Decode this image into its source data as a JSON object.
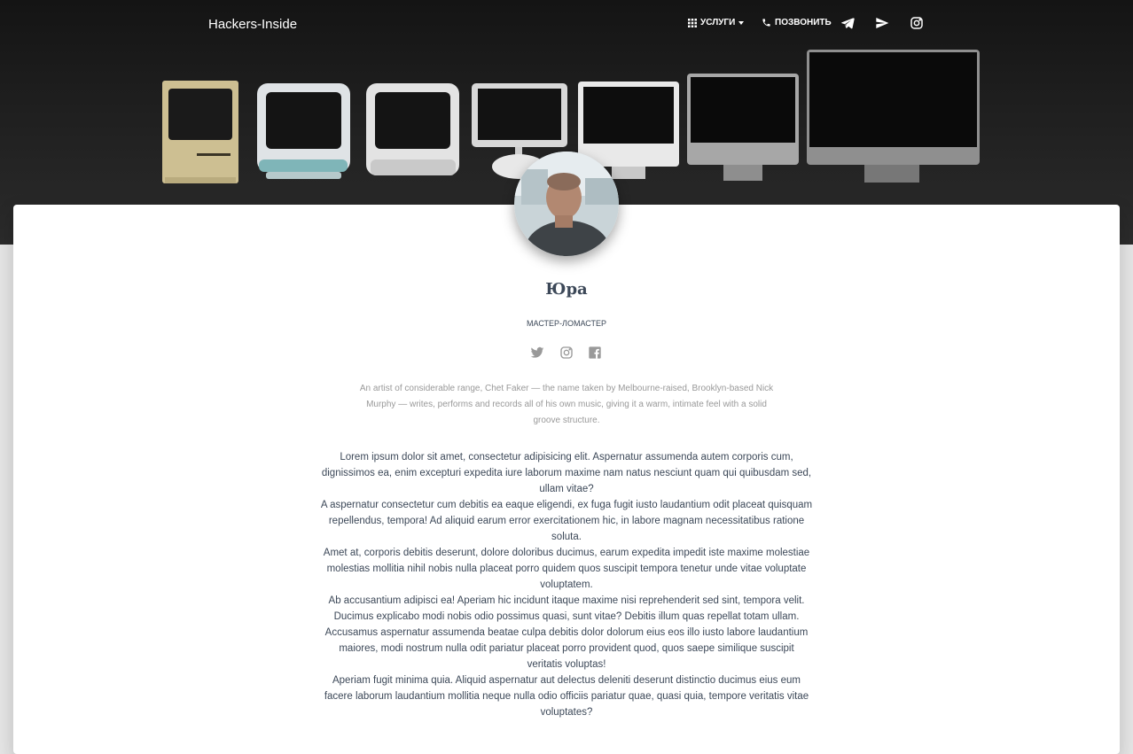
{
  "nav": {
    "brand": "Hackers-Inside",
    "services_label": "УСЛУГИ",
    "call_label": "ПОЗВОНИТЬ",
    "icons": [
      "apps-icon",
      "phone-icon",
      "telegram-icon",
      "send-icon",
      "instagram-icon"
    ]
  },
  "profile": {
    "name": "Юра",
    "title": "МАСТЕР-ЛОМАСТЕР",
    "social_icons": [
      "twitter-icon",
      "instagram-icon",
      "facebook-icon"
    ],
    "bio": "An artist of considerable range, Chet Faker — the name taken by Melbourne-raised, Brooklyn-based Nick Murphy — writes, performs and records all of his own music, giving it a warm, intimate feel with a solid groove structure."
  },
  "paragraphs": [
    "Lorem ipsum dolor sit amet, consectetur adipisicing elit. Aspernatur assumenda autem corporis cum, dignissimos ea, enim excepturi expedita iure laborum maxime nam natus nesciunt quam qui quibusdam sed, ullam vitae?",
    "A aspernatur consectetur cum debitis ea eaque eligendi, ex fuga fugit iusto laudantium odit placeat quisquam repellendus, tempora! Ad aliquid earum error exercitationem hic, in labore magnam necessitatibus ratione soluta.",
    "Amet at, corporis debitis deserunt, dolore doloribus ducimus, earum expedita impedit iste maxime molestiae molestias mollitia nihil nobis nulla placeat porro quidem quos suscipit tempora tenetur unde vitae voluptate voluptatem.",
    "Ab accusantium adipisci ea! Aperiam hic incidunt itaque maxime nisi reprehenderit sed sint, tempora velit. Ducimus explicabo modi nobis odio possimus quasi, sunt vitae? Debitis illum quas repellat totam ullam.",
    "Accusamus aspernatur assumenda beatae culpa debitis dolor dolorum eius eos illo iusto labore laudantium maiores, modi nostrum nulla odit pariatur placeat porro provident quod, quos saepe similique suscipit veritatis voluptas!",
    "Aperiam fugit minima quia. Aliquid aspernatur aut delectus deleniti deserunt distinctio ducimus eius eum facere laborum laudantium mollitia neque nulla odio officiis pariatur quae, quasi quia, tempore veritatis vitae voluptates?"
  ]
}
